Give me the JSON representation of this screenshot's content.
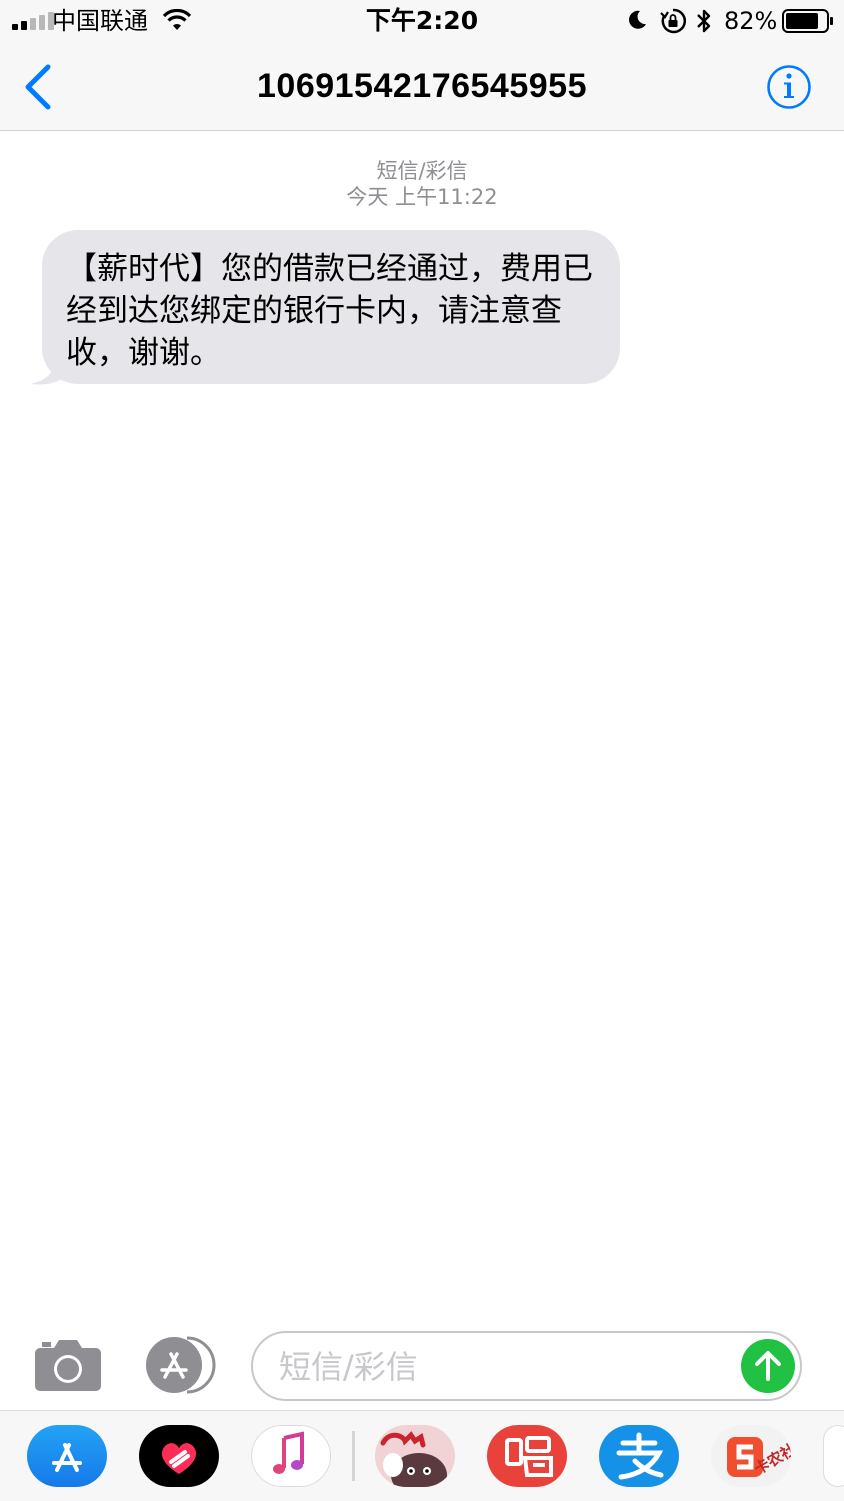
{
  "status_bar": {
    "carrier": "中国联通",
    "time": "下午2:20",
    "battery": "82%",
    "battery_level": 0.82
  },
  "nav": {
    "title": "1069154217​6545955"
  },
  "conversation": {
    "message_type": "短信/彩信",
    "timestamp": "今天 上午11:22",
    "messages": [
      {
        "text": "【薪时代】您的借款已经通过，费用已经到达您绑定的银行卡内，请注意查收，谢谢。",
        "direction": "incoming"
      }
    ]
  },
  "composer": {
    "placeholder": "短信/彩信"
  },
  "app_strip": {
    "apps": [
      "appstore-icon",
      "digital-touch-icon",
      "music-icon",
      "sticker-app-icon",
      "sing-app-icon",
      "alipay-icon",
      "sogou-app-icon"
    ],
    "watermark": "卡农社区",
    "colors": {
      "send": "#21c244",
      "blue": "#007aff",
      "bubble": "#e5e5ea"
    }
  }
}
